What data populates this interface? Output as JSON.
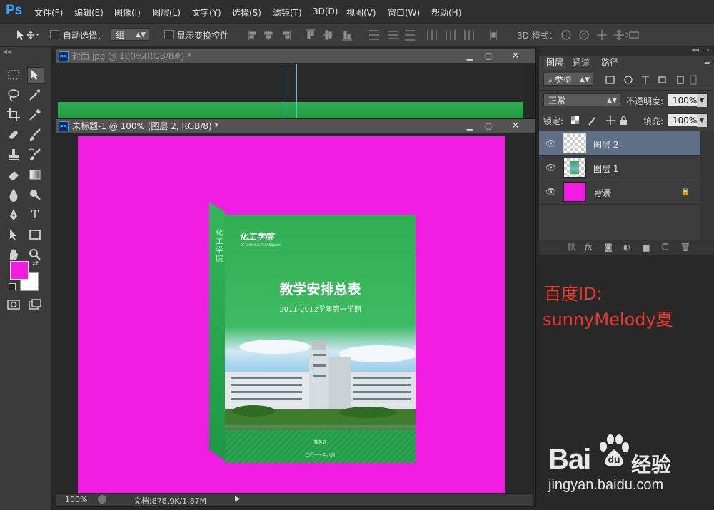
{
  "app": {
    "logo": "Ps"
  },
  "menu": [
    "文件(F)",
    "编辑(E)",
    "图像(I)",
    "图层(L)",
    "文字(Y)",
    "选择(S)",
    "滤镜(T)",
    "3D(D)",
    "视图(V)",
    "窗口(W)",
    "帮助(H)"
  ],
  "options": {
    "auto_select_label": "自动选择：",
    "auto_select_value": "组",
    "show_transform_label": "显示变换控件",
    "mode_3d_label": "3D 模式："
  },
  "doc1": {
    "icon": "PS",
    "title": "封面.jpg @ 100%(RGB/8#) *"
  },
  "doc2": {
    "icon": "PS",
    "title": "未标题-1 @ 100% (图层 2, RGB/8) *",
    "zoom": "100%",
    "doc_info": "文档:878.9K/1.87M"
  },
  "cover": {
    "school_logo": "化工学院",
    "school_sub": "OF CHEMICAL TECHNOLOGY",
    "title": "教学安排总表",
    "subtitle": "2011-2012学年第一学期",
    "footer_1": "教务处",
    "footer_2": "二〇一一年八月",
    "spine_text": "化工学院"
  },
  "panel": {
    "tabs": [
      "图层",
      "通道",
      "路径"
    ],
    "filter_label": "类型",
    "blend_mode": "正常",
    "opacity_label": "不透明度:",
    "opacity_value": "100%",
    "lock_label": "锁定:",
    "fill_label": "填充:",
    "fill_value": "100%",
    "layers": [
      {
        "name": "图层 2",
        "selected": true
      },
      {
        "name": "图层 1",
        "selected": false
      },
      {
        "name": "背景",
        "selected": false
      }
    ]
  },
  "watermark": {
    "id_line1": "百度ID:",
    "id_line2": "sunnyMelody夏",
    "baidu_brand": "Bai",
    "baidu_du": "du",
    "baidu_jy": "经验",
    "url": "jingyan.baidu.com"
  },
  "colors": {
    "foreground": "#f21de3",
    "background": "#ffffff",
    "canvas": "#f21de3",
    "accent_red": "#e83a2e",
    "cover_green": "#2fae52"
  }
}
